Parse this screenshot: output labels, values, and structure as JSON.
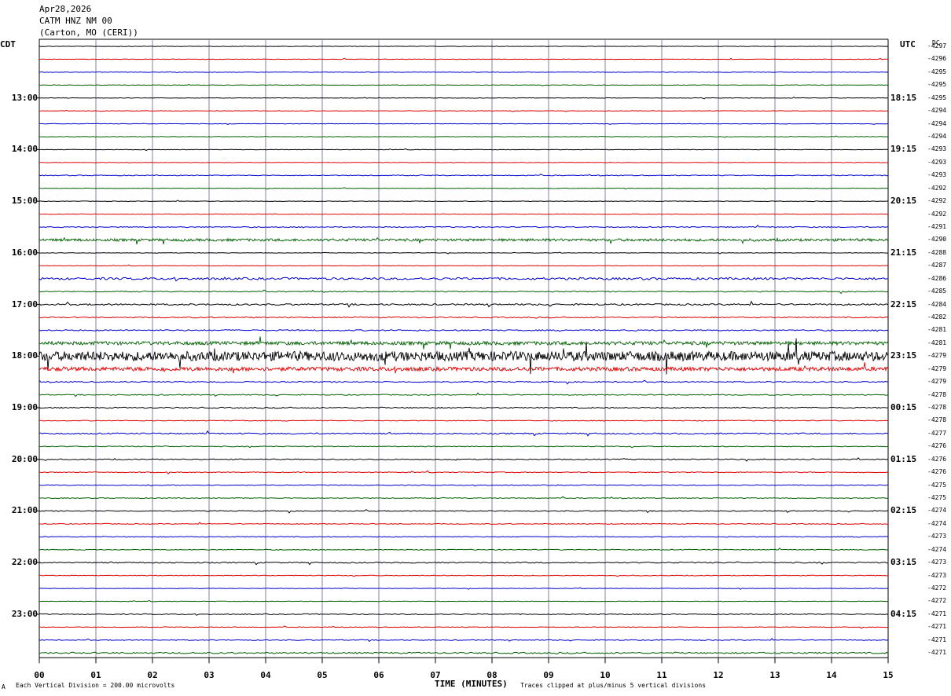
{
  "header": {
    "date": "Apr28,2026",
    "station": "CATM HNZ NM 00",
    "location": "(Carton, MO (CERI))"
  },
  "left_axis_label": "CDT",
  "right_axis_label": "UTC",
  "dc_label": "DC",
  "footer": {
    "scale": "Each Vertical Division =  200.00 microvolts",
    "xlabel": "TIME (MINUTES)",
    "clip": "Traces clipped at plus/minus 5 vertical divisions",
    "corner": "A"
  },
  "colors": {
    "black": "#000000",
    "red": "#e00000",
    "blue": "#0000d0",
    "green": "#006000",
    "grid": "#8080a0"
  },
  "chart_data": {
    "type": "line",
    "title": "",
    "xlabel": "TIME (MINUTES)",
    "ylabel": "",
    "x_ticks": [
      "00",
      "01",
      "02",
      "03",
      "04",
      "05",
      "06",
      "07",
      "08",
      "09",
      "10",
      "11",
      "12",
      "13",
      "14",
      "15"
    ],
    "xlim": [
      0,
      15
    ],
    "grid": true,
    "trace_colors_cycle": [
      "black",
      "red",
      "blue",
      "green"
    ],
    "left_hour_labels": [
      "13:00",
      "14:00",
      "15:00",
      "16:00",
      "17:00",
      "18:00",
      "19:00",
      "20:00",
      "21:00",
      "22:00",
      "23:00"
    ],
    "right_hour_labels": [
      "18:15",
      "19:15",
      "20:15",
      "21:15",
      "22:15",
      "23:15",
      "00:15",
      "01:15",
      "02:15",
      "03:15",
      "04:15"
    ],
    "dc_offsets": [
      "-4297",
      "-4296",
      "-4295",
      "-4295",
      "-4295",
      "-4294",
      "-4294",
      "-4294",
      "-4293",
      "-4293",
      "-4293",
      "-4292",
      "-4292",
      "-4292",
      "-4291",
      "-4290",
      "-4288",
      "-4287",
      "-4286",
      "-4285",
      "-4284",
      "-4282",
      "-4281",
      "-4281",
      "-4279",
      "-4279",
      "-4279",
      "-4278",
      "-4278",
      "-4278",
      "-4277",
      "-4276",
      "-4276",
      "-4276",
      "-4275",
      "-4275",
      "-4274",
      "-4274",
      "-4273",
      "-4274",
      "-4273",
      "-4273",
      "-4272",
      "-4272",
      "-4271",
      "-4271",
      "-4271",
      "-4271"
    ],
    "trace_activity": [
      0.3,
      0.3,
      0.3,
      0.3,
      0.3,
      0.3,
      0.3,
      0.3,
      0.3,
      0.3,
      0.5,
      0.3,
      0.3,
      0.3,
      0.6,
      1.6,
      0.3,
      0.3,
      1.4,
      0.6,
      1.0,
      0.7,
      0.8,
      2.2,
      6.0,
      2.5,
      0.7,
      0.6,
      0.7,
      0.5,
      0.8,
      0.5,
      0.6,
      0.5,
      0.5,
      0.5,
      0.6,
      0.5,
      0.5,
      0.5,
      0.7,
      0.4,
      0.3,
      0.3,
      0.6,
      0.4,
      0.5,
      0.9
    ]
  }
}
